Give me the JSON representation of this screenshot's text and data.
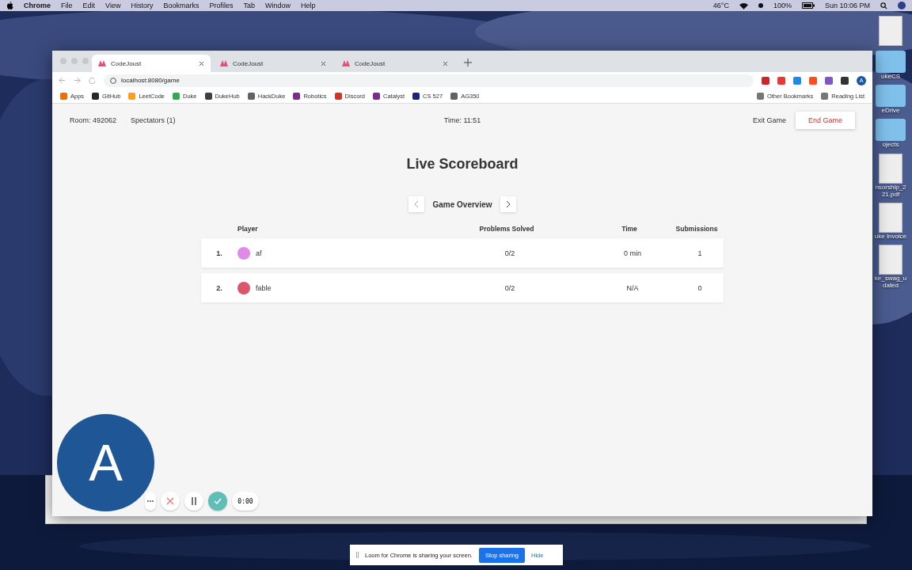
{
  "menu_bar": {
    "app": "Chrome",
    "items": [
      "File",
      "Edit",
      "View",
      "History",
      "Bookmarks",
      "Profiles",
      "Tab",
      "Window",
      "Help"
    ],
    "temperature": "46°C",
    "battery": "100%",
    "clock": "Sun 10:06 PM"
  },
  "desktop_icons": [
    {
      "kind": "document"
    },
    {
      "kind": "folder",
      "lines": [
        "ukeCS"
      ]
    },
    {
      "kind": "folder",
      "lines": [
        "eDrive"
      ]
    },
    {
      "kind": "folder",
      "lines": [
        "ojects"
      ]
    },
    {
      "kind": "document",
      "lines": [
        "nsorship_2",
        "21.pdf"
      ]
    },
    {
      "kind": "document",
      "lines": [
        "uke Invoice"
      ]
    },
    {
      "kind": "document",
      "lines": [
        "ke_swag_u",
        "dated"
      ]
    }
  ],
  "browser": {
    "tabs": [
      {
        "title": "CodeJoust",
        "selected": true
      },
      {
        "title": "CodeJoust",
        "selected": false
      },
      {
        "title": "CodeJoust",
        "selected": false
      }
    ],
    "address": "localhost:8080/game",
    "profile_initial": "A",
    "bookmarks": [
      {
        "label": "Apps",
        "color": "#e8710a"
      },
      {
        "label": "GitHub",
        "color": "#24292e"
      },
      {
        "label": "LeetCode",
        "color": "#f89f1b"
      },
      {
        "label": "Duke",
        "color": "#34a853"
      },
      {
        "label": "DukeHub",
        "color": "#3c4043"
      },
      {
        "label": "HackDuke",
        "color": "#5f6368"
      },
      {
        "label": "Robotics",
        "color": "#7b2d8e"
      },
      {
        "label": "Discord",
        "color": "#d93025"
      },
      {
        "label": "Catalyst",
        "color": "#7b2d8e"
      },
      {
        "label": "CS 527",
        "color": "#1a237e"
      },
      {
        "label": "AG350",
        "color": "#5f6368"
      }
    ],
    "bookmarks_right": [
      "Other Bookmarks",
      "Reading List"
    ]
  },
  "game": {
    "room": "Room: 492062",
    "spectators": "Spectators (1)",
    "time": "Time: 11:51",
    "exit": "Exit Game",
    "end": "End Game",
    "title": "Live Scoreboard",
    "view": "Game Overview",
    "columns": [
      "Player",
      "Problems Solved",
      "Time",
      "Submissions"
    ],
    "rows": [
      {
        "rank": "1.",
        "name": "af",
        "color": "#e08ae8",
        "solved": "0/2",
        "time": "0 min",
        "submissions": "1"
      },
      {
        "rank": "2.",
        "name": "fable",
        "color": "#d9566b",
        "solved": "0/2",
        "time": "N/A",
        "submissions": "0"
      }
    ]
  },
  "loom": {
    "initial": "A",
    "timer": "0:00",
    "banner": "Loom for Chrome is sharing your screen.",
    "stop": "Stop sharing",
    "hide": "Hide"
  }
}
